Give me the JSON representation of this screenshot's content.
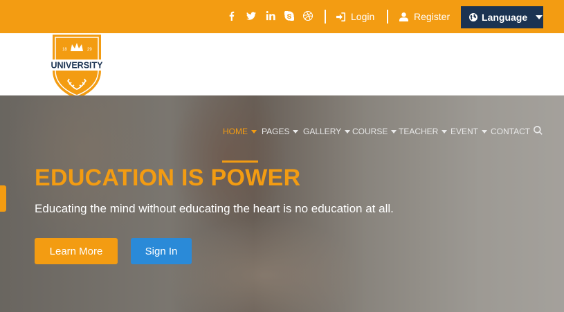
{
  "topbar": {
    "social": [
      {
        "name": "facebook-icon"
      },
      {
        "name": "twitter-icon"
      },
      {
        "name": "linkedin-icon"
      },
      {
        "name": "skype-icon"
      },
      {
        "name": "dribbble-icon"
      }
    ],
    "login_label": "Login",
    "register_label": "Register",
    "language_label": "Language"
  },
  "logo": {
    "year_left": "18",
    "year_right": "29",
    "text": "UNIVERSITY"
  },
  "nav": {
    "items": [
      {
        "label": "HOME"
      },
      {
        "label": "PAGES"
      },
      {
        "label": "GALLERY"
      },
      {
        "label": "COURSE"
      },
      {
        "label": "TEACHER"
      },
      {
        "label": "EVENT"
      },
      {
        "label": "CONTACT"
      }
    ]
  },
  "hero": {
    "title": "EDUCATION IS POWER",
    "subtitle": "Educating the mind without educating the heart is no education at all.",
    "learn_more": "Learn More",
    "sign_in": "Sign In"
  },
  "colors": {
    "accent": "#f39c12",
    "navy": "#1b3352",
    "blue": "#2a8ad8"
  }
}
